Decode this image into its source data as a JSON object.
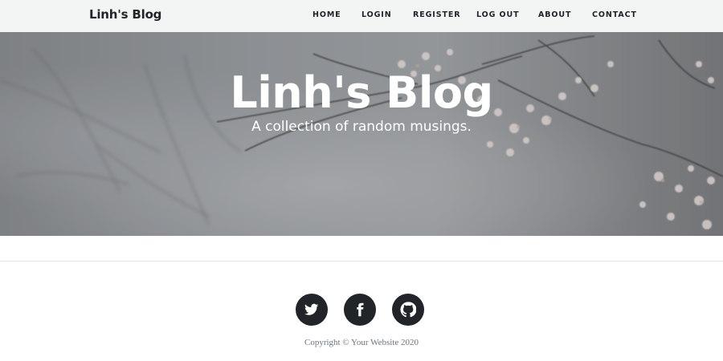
{
  "brand": "Linh's Blog",
  "nav": {
    "home": "HOME",
    "login": "LOGIN",
    "register": "REGISTER",
    "logout": "LOG OUT",
    "about": "ABOUT",
    "contact": "CONTACT"
  },
  "hero": {
    "title": "Linh's Blog",
    "subtitle": "A collection of random musings.",
    "background": "cherry-blossom-branches-photo"
  },
  "footer": {
    "social_icons": [
      "twitter-icon",
      "facebook-icon",
      "github-icon"
    ],
    "copyright": "Copyright © Your Website 2020"
  },
  "colors": {
    "navbar_bg": "#f3f4f4",
    "text_dark": "#212529",
    "hero_overlay": "#8e9195",
    "footer_text": "#6c757d"
  }
}
